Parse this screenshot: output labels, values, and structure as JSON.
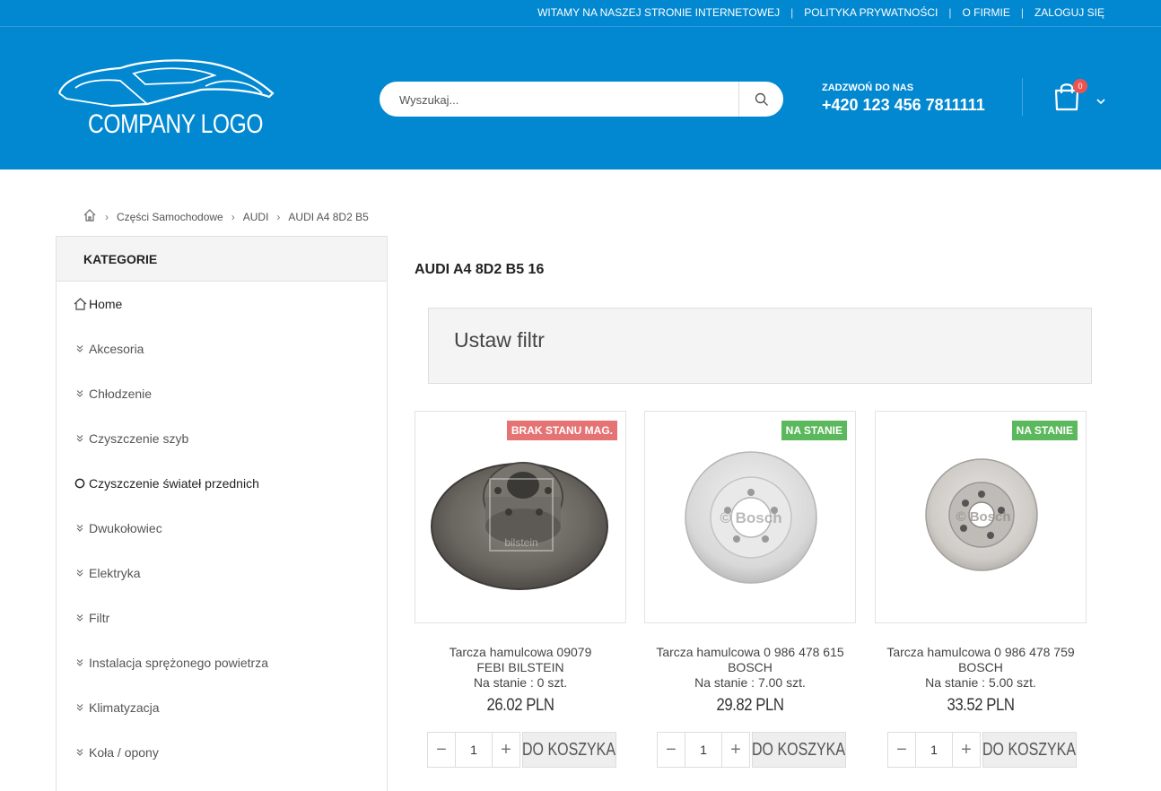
{
  "topbar": {
    "links": [
      "WITAMY NA NASZEJ STRONIE INTERNETOWEJ",
      "POLITYKA PRYWATNOŚCI",
      "O FIRMIE",
      "ZALOGUJ SIĘ"
    ]
  },
  "logo": {
    "text": "COMPANY LOGO"
  },
  "search": {
    "placeholder": "Wyszukaj..."
  },
  "contact": {
    "label": "ZADZWOŃ DO NAS",
    "phone": "+420 123 456 7811111"
  },
  "cart": {
    "count": "0"
  },
  "breadcrumb": [
    "Części Samochodowe",
    "AUDI",
    "AUDI A4 8D2 B5"
  ],
  "sidebar": {
    "title": "KATEGORIE",
    "items": [
      {
        "label": "Home",
        "icon": "home-icon"
      },
      {
        "label": "Akcesoria",
        "icon": "chevron-double-down-icon"
      },
      {
        "label": "Chłodzenie",
        "icon": "chevron-double-down-icon"
      },
      {
        "label": "Czyszczenie szyb",
        "icon": "chevron-double-down-icon"
      },
      {
        "label": "Czyszczenie świateł przednich",
        "icon": "circle-icon"
      },
      {
        "label": "Dwukołowiec",
        "icon": "chevron-double-down-icon"
      },
      {
        "label": "Elektryka",
        "icon": "chevron-double-down-icon"
      },
      {
        "label": "Filtr",
        "icon": "chevron-double-down-icon"
      },
      {
        "label": "Instalacja sprężonego powietrza",
        "icon": "chevron-double-down-icon"
      },
      {
        "label": "Klimatyzacja",
        "icon": "chevron-double-down-icon"
      },
      {
        "label": "Koła / opony",
        "icon": "chevron-double-down-icon"
      }
    ]
  },
  "main": {
    "title": "AUDI A4 8D2 B5 16",
    "filter_title": "Ustaw filtr"
  },
  "products": [
    {
      "badge": "BRAK STANU MAG.",
      "badge_color": "#e57373",
      "name_line1": "Tarcza hamulcowa 09079",
      "name_line2": "FEBI BILSTEIN",
      "stock": "Na stanie : 0 szt.",
      "price": "26.02 PLN",
      "qty": "1",
      "add_label": "DO KOSZYKA",
      "watermark": "bilstein"
    },
    {
      "badge": "NA STANIE",
      "badge_color": "#5cb85c",
      "name_line1": "Tarcza hamulcowa 0 986 478 615",
      "name_line2": "BOSCH",
      "stock": "Na stanie : 7.00 szt.",
      "price": "29.82 PLN",
      "qty": "1",
      "add_label": "DO KOSZYKA",
      "watermark": "© Bosch"
    },
    {
      "badge": "NA STANIE",
      "badge_color": "#5cb85c",
      "name_line1": "Tarcza hamulcowa 0 986 478 759",
      "name_line2": "BOSCH",
      "stock": "Na stanie : 5.00 szt.",
      "price": "33.52 PLN",
      "qty": "1",
      "add_label": "DO KOSZYKA",
      "watermark": "© Bosch"
    }
  ],
  "colors": {
    "header": "#0288d1",
    "badge_out": "#e57373",
    "badge_in": "#5cb85c",
    "cart_badge": "#ef5350"
  }
}
